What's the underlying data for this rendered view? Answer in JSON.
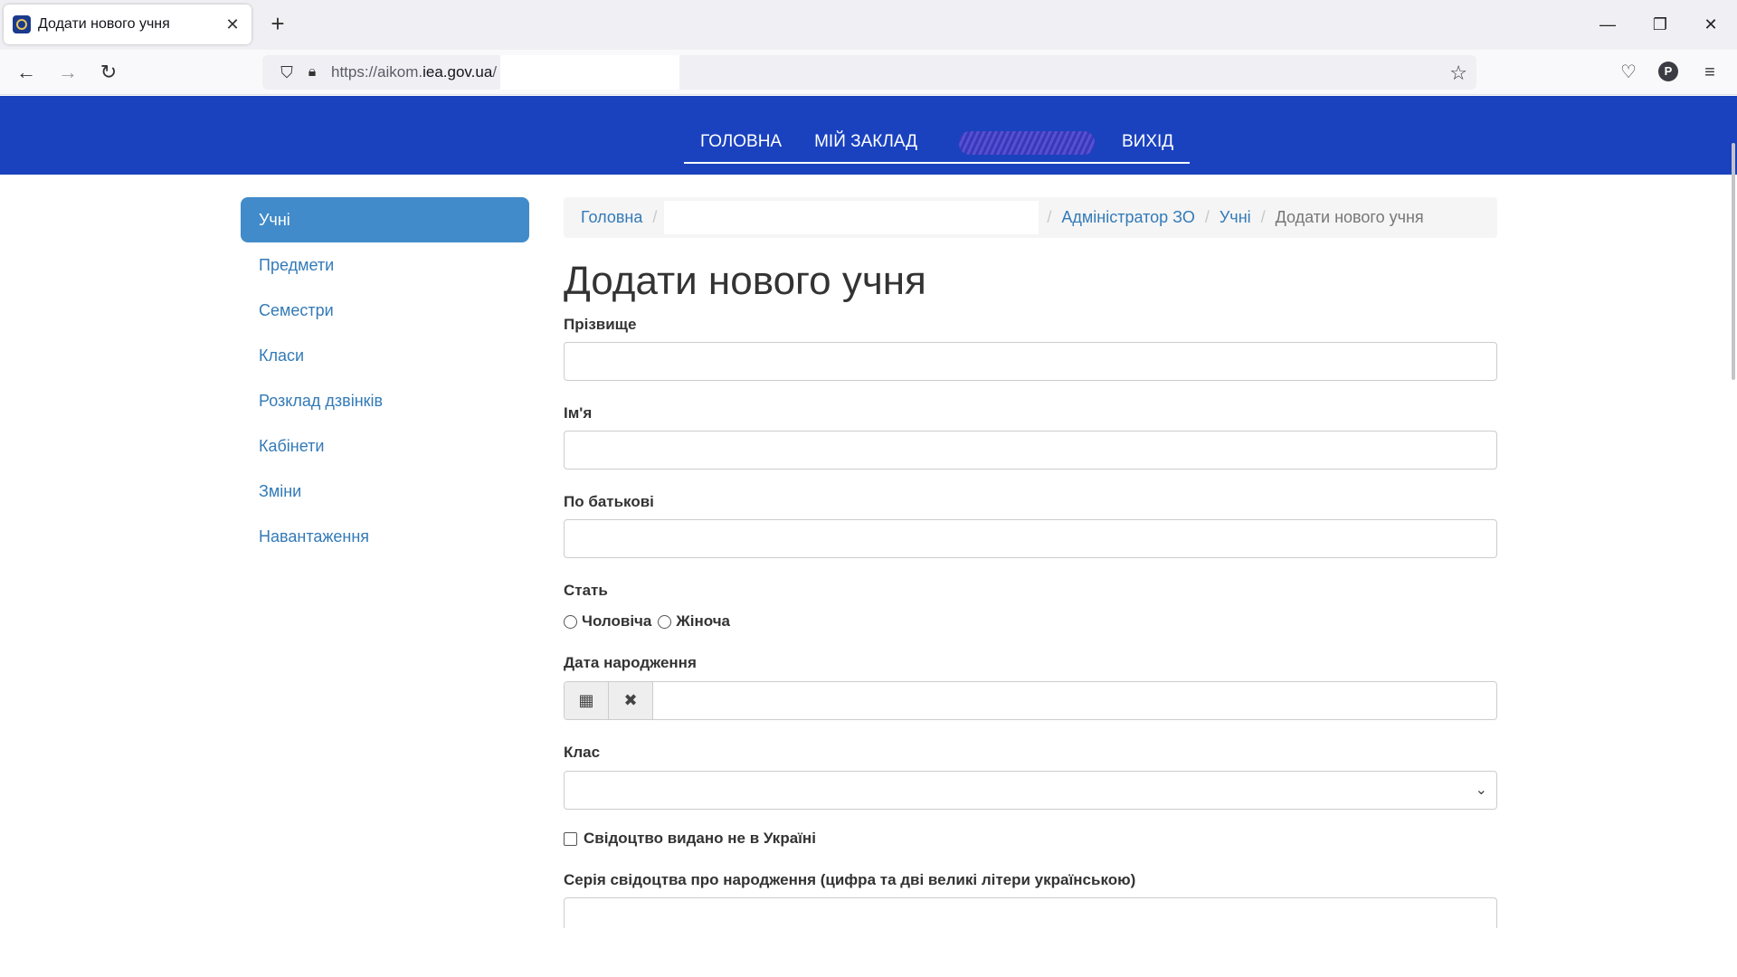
{
  "browser": {
    "tab_title": "Додати нового учня",
    "tab_close": "✕",
    "new_tab": "+",
    "url_prefix": "https://aikom.",
    "url_domain": "iea.gov.ua",
    "url_suffix": "/",
    "profile_initial": "P"
  },
  "header": {
    "nav": [
      "ГОЛОВНА",
      "МІЙ ЗАКЛАД",
      "ВИХІД"
    ]
  },
  "sidebar": {
    "items": [
      {
        "label": "Учні",
        "active": true
      },
      {
        "label": "Предмети"
      },
      {
        "label": "Семестри"
      },
      {
        "label": "Класи"
      },
      {
        "label": "Розклад дзвінків"
      },
      {
        "label": "Кабінети"
      },
      {
        "label": "Зміни"
      },
      {
        "label": "Навантаження"
      }
    ]
  },
  "breadcrumb": {
    "home": "Головна",
    "admin": "Адміністратор ЗО",
    "students": "Учні",
    "current": "Додати нового учня",
    "separator": "/"
  },
  "form": {
    "title": "Додати нового учня",
    "surname_label": "Прізвище",
    "name_label": "Ім'я",
    "patronymic_label": "По батькові",
    "gender_label": "Стать",
    "gender_options": [
      "Чоловіча",
      "Жіноча"
    ],
    "birthdate_label": "Дата народження",
    "class_label": "Клас",
    "certificate_abroad_label": "Свідоцтво видано не в Україні",
    "cert_series_label": "Серія свідоцтва про народження (цифра та дві великі літери українською)"
  }
}
